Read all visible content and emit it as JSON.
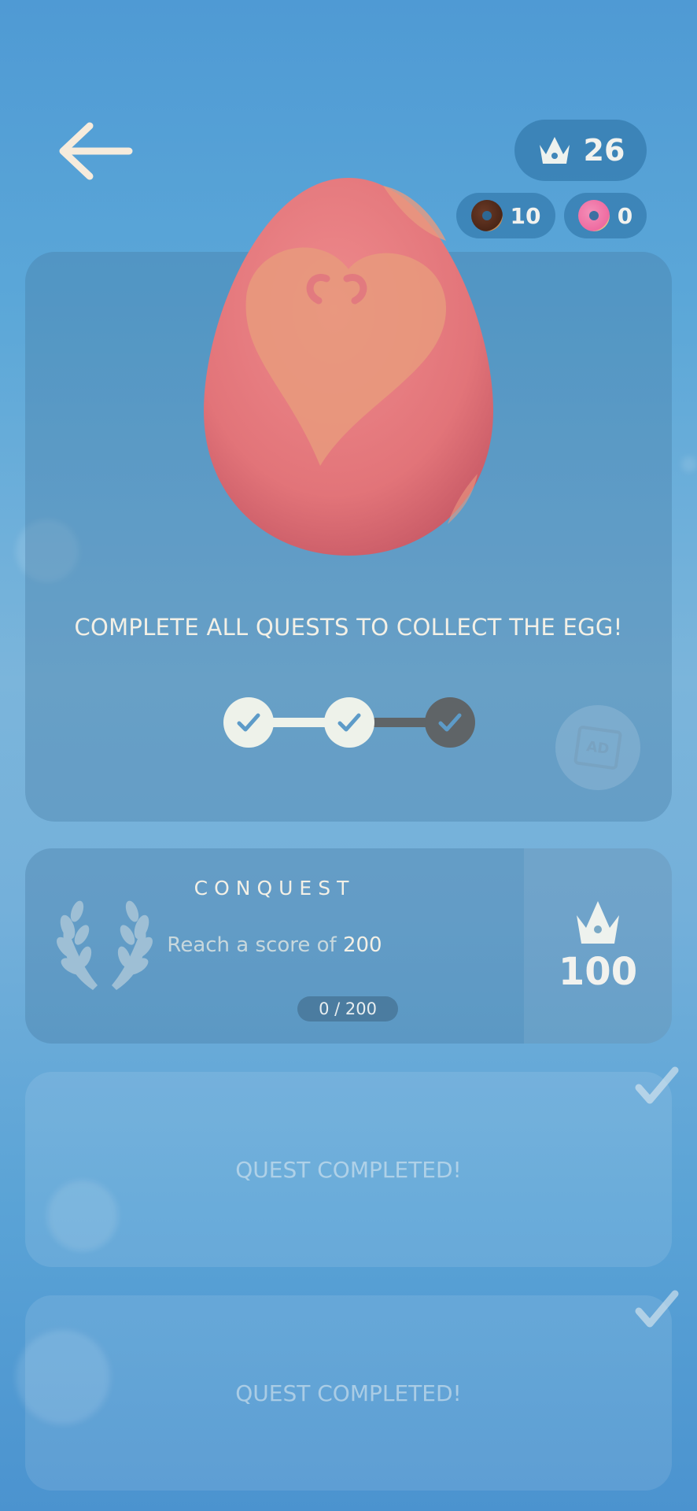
{
  "header": {
    "crowns": "26",
    "chocolate_donuts": "10",
    "pink_donuts": "0"
  },
  "egg_panel": {
    "title": "COMPLETE ALL QUESTS TO COLLECT THE EGG!",
    "quests_completed": 2,
    "quests_total": 3,
    "ad_label": "AD"
  },
  "active_quest": {
    "name": "CONQUEST",
    "desc_prefix": "Reach a score of ",
    "desc_target": "200",
    "progress": "0 / 200",
    "reward": "100"
  },
  "completed_quests": [
    {
      "label": "QUEST COMPLETED!"
    },
    {
      "label": "QUEST COMPLETED!"
    }
  ],
  "colors": {
    "egg": "#e9777e",
    "heart": "#e79a7c",
    "accent_cream": "#f3f0e6"
  }
}
